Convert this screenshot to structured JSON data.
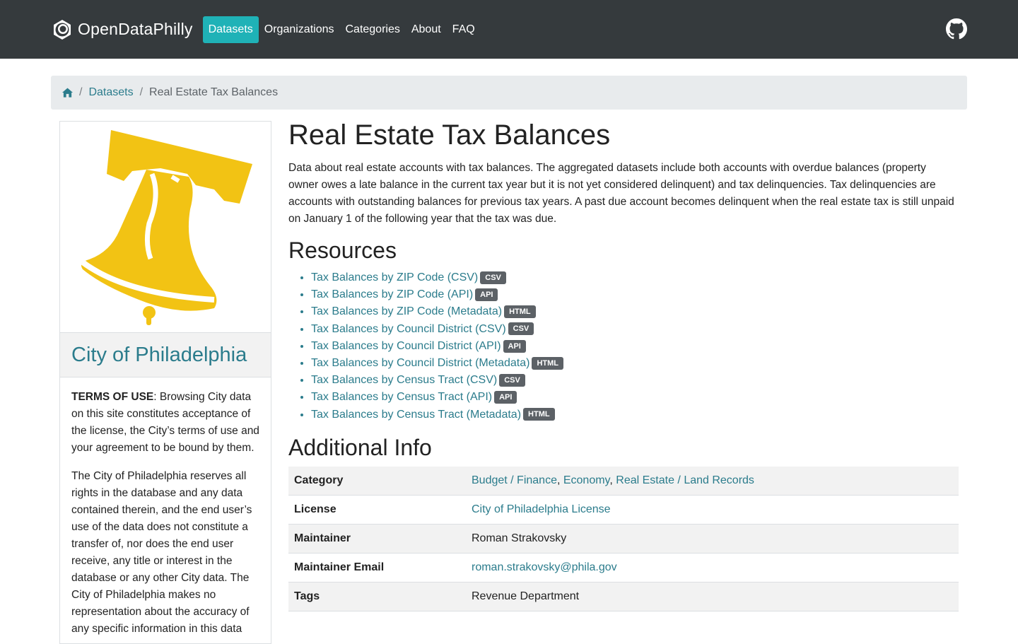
{
  "nav": {
    "brand": "OpenDataPhilly",
    "items": [
      {
        "label": "Datasets",
        "active": true
      },
      {
        "label": "Organizations",
        "active": false
      },
      {
        "label": "Categories",
        "active": false
      },
      {
        "label": "About",
        "active": false
      },
      {
        "label": "FAQ",
        "active": false
      }
    ]
  },
  "breadcrumb": {
    "items": [
      "Datasets"
    ],
    "current": "Real Estate Tax Balances"
  },
  "sidebar": {
    "org_name": "City of Philadelphia",
    "terms_label": "TERMS OF USE",
    "terms_text": ": Browsing City data on this site constitutes acceptance of the license, the City’s terms of use and your agreement to be bound by them.",
    "rights_text": "The City of Philadelphia reserves all rights in the database and any data contained therein, and the end user’s use of the data does not constitute a transfer of, nor does the end user receive, any title or interest in the database or any other City data. The City of Philadelphia makes no representation about the accuracy of any specific information in this data"
  },
  "dataset": {
    "title": "Real Estate Tax Balances",
    "description": "Data about real estate accounts with tax balances. The aggregated datasets include both accounts with overdue balances (property owner owes a late balance in the current tax year but it is not yet considered delinquent) and tax delinquencies. Tax delinquencies are accounts with outstanding balances for previous tax years. A past due account becomes delinquent when the real estate tax is still unpaid on January 1 of the following year that the tax was due.",
    "resources_heading": "Resources",
    "resources": [
      {
        "label": "Tax Balances by ZIP Code (CSV)",
        "format": "CSV"
      },
      {
        "label": "Tax Balances by ZIP Code (API)",
        "format": "API"
      },
      {
        "label": "Tax Balances by ZIP Code (Metadata)",
        "format": "HTML"
      },
      {
        "label": "Tax Balances by Council District (CSV)",
        "format": "CSV"
      },
      {
        "label": "Tax Balances by Council District (API)",
        "format": "API"
      },
      {
        "label": "Tax Balances by Council District (Metadata)",
        "format": "HTML"
      },
      {
        "label": "Tax Balances by Census Tract (CSV)",
        "format": "CSV"
      },
      {
        "label": "Tax Balances by Census Tract (API)",
        "format": "API"
      },
      {
        "label": "Tax Balances by Census Tract (Metadata)",
        "format": "HTML"
      }
    ],
    "info_heading": "Additional Info",
    "info": {
      "category_label": "Category",
      "categories": [
        "Budget / Finance",
        "Economy",
        "Real Estate / Land Records"
      ],
      "license_label": "License",
      "license": "City of Philadelphia License",
      "maintainer_label": "Maintainer",
      "maintainer": "Roman Strakovsky",
      "email_label": "Maintainer Email",
      "email": "roman.strakovsky@phila.gov",
      "tags_label": "Tags",
      "tags": "Revenue Department"
    }
  },
  "colors": {
    "navbar": "#353a3d",
    "accent": "#1fb2b7",
    "link": "#2b7c8c",
    "bell": "#f2c314"
  }
}
